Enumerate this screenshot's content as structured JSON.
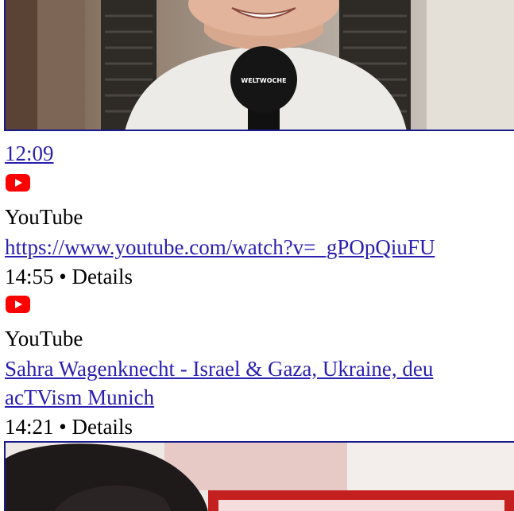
{
  "items": [
    {
      "duration": "12:09",
      "source": "YouTube",
      "url": "https://www.youtube.com/watch?v=_gPOpQiuFU",
      "time": "14:55",
      "separator": "•",
      "details": "Details"
    },
    {
      "source": "YouTube",
      "title": "Sahra Wagenknecht - Israel & Gaza, Ukraine, deu",
      "channel": "acTVism Munich",
      "time": "14:21",
      "separator": "•",
      "details": "Details"
    }
  ],
  "thumbnail_top": {
    "microphone_brand": "WELTWOCHE"
  },
  "icons": {
    "youtube": "youtube-play-icon"
  },
  "colors": {
    "link": "#2a1fb0",
    "youtube_red": "#ff0000",
    "thumbnail_border": "#1a1a8c"
  }
}
